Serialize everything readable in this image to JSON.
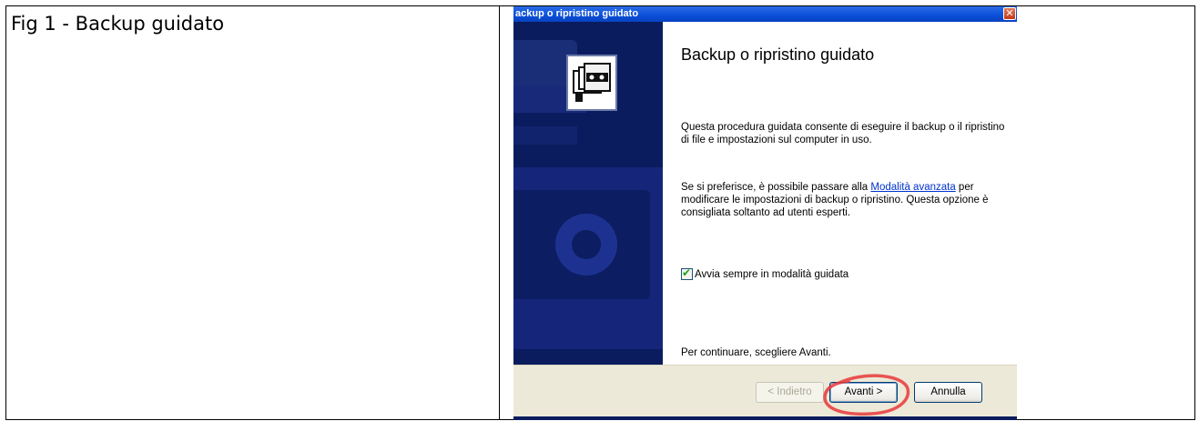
{
  "document": {
    "caption": "Fig 1 - Backup guidato"
  },
  "dialog": {
    "window_title": "ackup o ripristino guidato",
    "close_glyph": "✕",
    "icon": "backup-tapes-icon",
    "heading": "Backup o ripristino guidato",
    "intro": "Questa procedura guidata consente di eseguire il backup o il ripristino di file e impostazioni sul computer in uso.",
    "advanced_text_before": "Se si preferisce, è possibile passare alla ",
    "advanced_link": "Modalità avanzata",
    "advanced_text_after": " per modificare le impostazioni di backup o ripristino. Questa opzione è consigliata soltanto ad utenti esperti.",
    "checkbox": {
      "label": "Avvia sempre in modalità guidata",
      "checked": true
    },
    "continue_text": "Per continuare, scegliere Avanti.",
    "buttons": {
      "back": "< Indietro",
      "next": "Avanti >",
      "cancel": "Annulla"
    }
  },
  "colors": {
    "titlebar": "#0a4fd8",
    "side_panel": "#0a1c5e",
    "button_bar": "#ece9d8",
    "annotation_ring": "#e8383a"
  }
}
